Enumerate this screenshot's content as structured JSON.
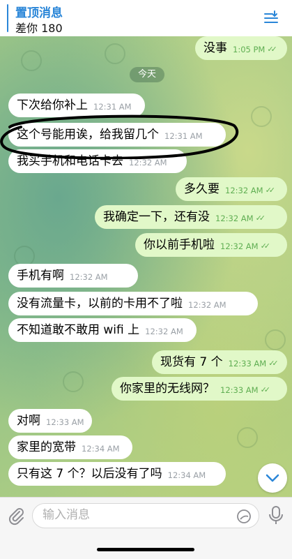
{
  "pinned": {
    "title": "置顶消息",
    "preview": "差你 180"
  },
  "date_label": "今天",
  "messages": [
    {
      "side": "out",
      "text": "没事",
      "time": "1:05 PM"
    },
    {
      "side": "in",
      "text": "下次给你补上",
      "time": "12:31 AM"
    },
    {
      "side": "in",
      "text": "这个号能用诶，给我留几个",
      "time": "12:31 AM"
    },
    {
      "side": "in",
      "text": "我买手机和电话卡去",
      "time": "12:32 AM"
    },
    {
      "side": "out",
      "text": "多久要",
      "time": "12:32 AM"
    },
    {
      "side": "out",
      "text": "我确定一下，还有没",
      "time": "12:32 AM"
    },
    {
      "side": "out",
      "text": "你以前手机啦",
      "time": "12:32 AM"
    },
    {
      "side": "in",
      "text": "手机有啊",
      "time": "12:32 AM"
    },
    {
      "side": "in",
      "text": "没有流量卡，以前的卡用不了啦",
      "time": "12:32 AM"
    },
    {
      "side": "in",
      "text": "不知道敢不敢用 wifi 上",
      "time": "12:32 AM"
    },
    {
      "side": "out",
      "text": "现货有 7 个",
      "time": "12:33 AM"
    },
    {
      "side": "out",
      "text": "你家里的无线网？",
      "time": "12:33 AM"
    },
    {
      "side": "in",
      "text": "对啊",
      "time": "12:33 AM"
    },
    {
      "side": "in",
      "text": "家里的宽带",
      "time": "12:34 AM"
    },
    {
      "side": "in",
      "text": "只有这 7 个？以后没有了吗",
      "time": "12:34 AM"
    }
  ],
  "input": {
    "placeholder": "输入消息"
  },
  "colors": {
    "accent": "#2a86d8",
    "outgoing_bubble": "#e1f8c8",
    "read_check": "#5fae52"
  },
  "icons": [
    "pinned-list-icon",
    "paperclip-icon",
    "sticker-icon",
    "mic-icon",
    "chevron-down-icon",
    "double-check-icon"
  ]
}
